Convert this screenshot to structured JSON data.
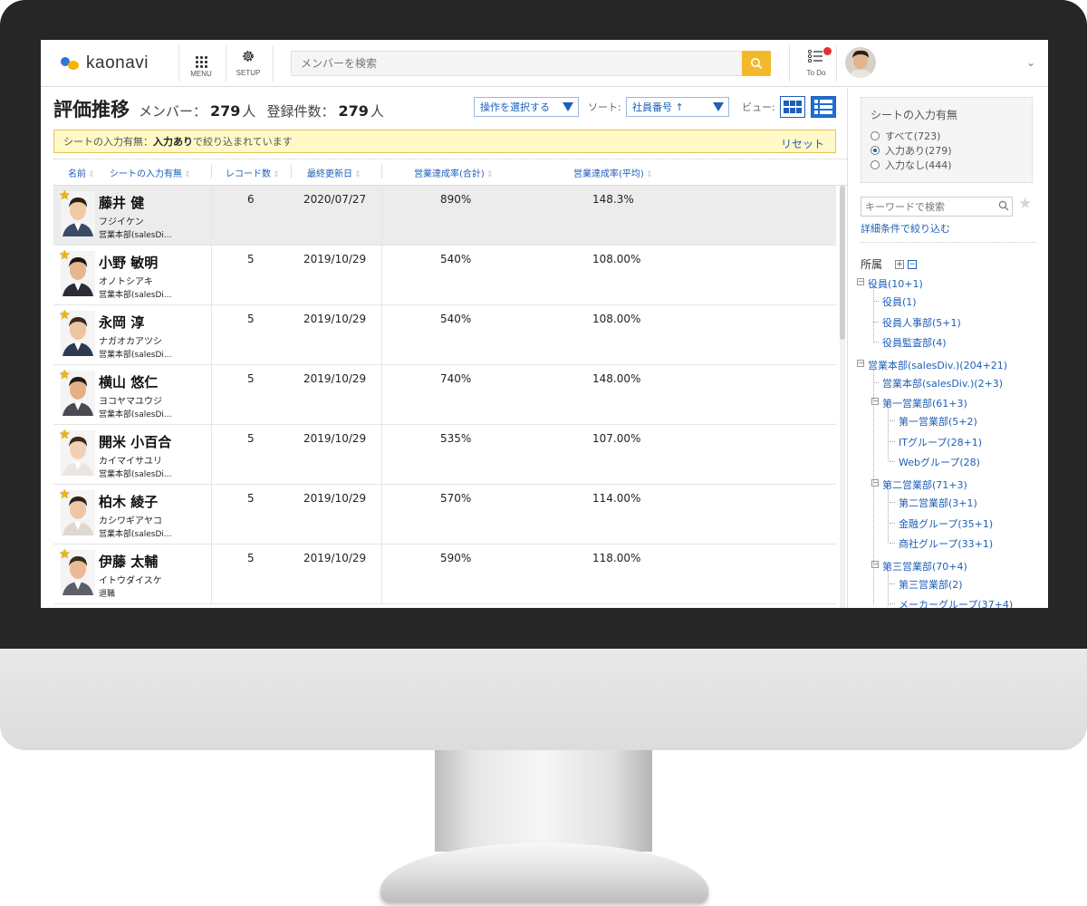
{
  "header": {
    "logo_text": "kaonavi",
    "menu_label": "MENU",
    "setup_label": "SETUP",
    "search_placeholder": "メンバーを検索",
    "todo_label": "To Do"
  },
  "page": {
    "title": "評価推移",
    "members_label": "メンバー：",
    "members_count": "279",
    "members_unit": "人",
    "records_label": "登録件数：",
    "records_count": "279",
    "records_unit": "人",
    "action_select": "操作を選択する",
    "sort_label": "ソート:",
    "sort_value": "社員番号 ↑",
    "view_label": "ビュー:"
  },
  "filter_banner": {
    "prefix": "シートの入力有無：",
    "value": "入力あり",
    "suffix": " で絞り込まれています",
    "reset": "リセット"
  },
  "table": {
    "headers": {
      "name": "名前",
      "sheet": "シートの入力有無",
      "records": "レコード数",
      "updated": "最終更新日",
      "total": "営業達成率(合計)",
      "average": "営業達成率(平均)"
    },
    "rows": [
      {
        "name": "藤井 健",
        "kana": "フジイケン",
        "dept": "営業本部(salesDi...",
        "records": "6",
        "updated": "2020/07/27",
        "total": "890%",
        "average": "148.3%"
      },
      {
        "name": "小野 敏明",
        "kana": "オノトシアキ",
        "dept": "営業本部(salesDi...",
        "records": "5",
        "updated": "2019/10/29",
        "total": "540%",
        "average": "108.00%"
      },
      {
        "name": "永岡 淳",
        "kana": "ナガオカアツシ",
        "dept": "営業本部(salesDi...",
        "records": "5",
        "updated": "2019/10/29",
        "total": "540%",
        "average": "108.00%"
      },
      {
        "name": "横山 悠仁",
        "kana": "ヨコヤマユウジ",
        "dept": "営業本部(salesDi...",
        "records": "5",
        "updated": "2019/10/29",
        "total": "740%",
        "average": "148.00%"
      },
      {
        "name": "開米 小百合",
        "kana": "カイマイサユリ",
        "dept": "営業本部(salesDi...",
        "records": "5",
        "updated": "2019/10/29",
        "total": "535%",
        "average": "107.00%"
      },
      {
        "name": "柏木 綾子",
        "kana": "カシワギアヤコ",
        "dept": "営業本部(salesDi...",
        "records": "5",
        "updated": "2019/10/29",
        "total": "570%",
        "average": "114.00%"
      },
      {
        "name": "伊藤 太輔",
        "kana": "イトウダイスケ",
        "dept": "退職",
        "records": "5",
        "updated": "2019/10/29",
        "total": "590%",
        "average": "118.00%"
      }
    ]
  },
  "sidebar": {
    "sheet_filter_title": "シートの入力有無",
    "options": [
      {
        "label": "すべて(723)",
        "selected": false
      },
      {
        "label": "入力あり(279)",
        "selected": true
      },
      {
        "label": "入力なし(444)",
        "selected": false
      }
    ],
    "keyword_placeholder": "キーワードで検索",
    "advanced_link": "詳細条件で絞り込む",
    "tree_title": "所属",
    "tree": [
      "役員(10+1)",
      "役員(1)",
      "役員人事部(5+1)",
      "役員監査部(4)",
      "営業本部(salesDiv.)(204+21)",
      "営業本部(salesDiv.)(2+3)",
      "第一営業部(61+3)",
      "第一営業部(5+2)",
      "ITグループ(28+1)",
      "Webグループ(28)",
      "第二営業部(71+3)",
      "第二営業部(3+1)",
      "金融グループ(35+1)",
      "商社グループ(33+1)",
      "第三営業部(70+4)",
      "第三営業部(2)",
      "メーカーグループ(37+4)"
    ]
  },
  "colors": {
    "accent": "#1d5fb8",
    "banner_bg": "#fff8c7",
    "search_button": "#f4b92b",
    "notification": "#e83030",
    "bezel": "#262626"
  }
}
